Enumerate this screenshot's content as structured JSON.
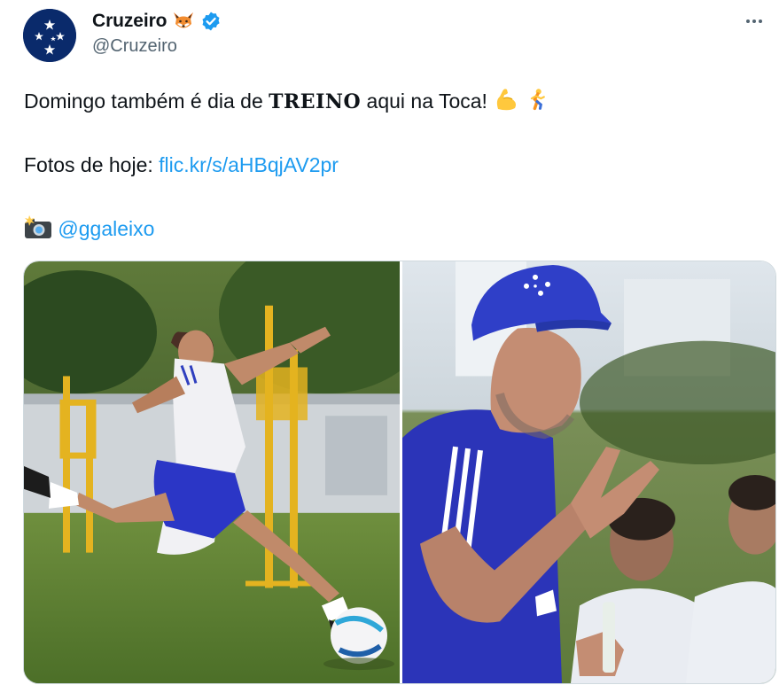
{
  "tweet": {
    "author": {
      "display_name": "Cruzeiro",
      "handle": "@Cruzeiro",
      "name_emoji": "fox-emoji",
      "verified_badge": "verified-badge-icon",
      "avatar": "cruzeiro-crest-avatar"
    },
    "menu_icon": "more-options-icon",
    "text": {
      "line1_before": "Domingo também é dia de ",
      "line1_bold": "TREINO",
      "line1_after": " aqui na Toca! ",
      "line1_emojis": [
        "flexed-biceps-emoji",
        "person-running-emoji"
      ],
      "line2_label": "Fotos de hoje: ",
      "line2_link": "flic.kr/s/aHBqjAV2pr",
      "line3_emoji": "camera-with-flash-emoji",
      "line3_mention": "@ggaleixo"
    },
    "media": {
      "photos": [
        {
          "name": "player-kicking-ball-photo"
        },
        {
          "name": "coach-gesturing-photo"
        }
      ]
    }
  },
  "colors": {
    "text": "#0f1419",
    "secondary": "#536471",
    "link": "#1d9bf0",
    "verified": "#1d9bf0",
    "cruzeiro_blue": "#2b3cc4"
  }
}
